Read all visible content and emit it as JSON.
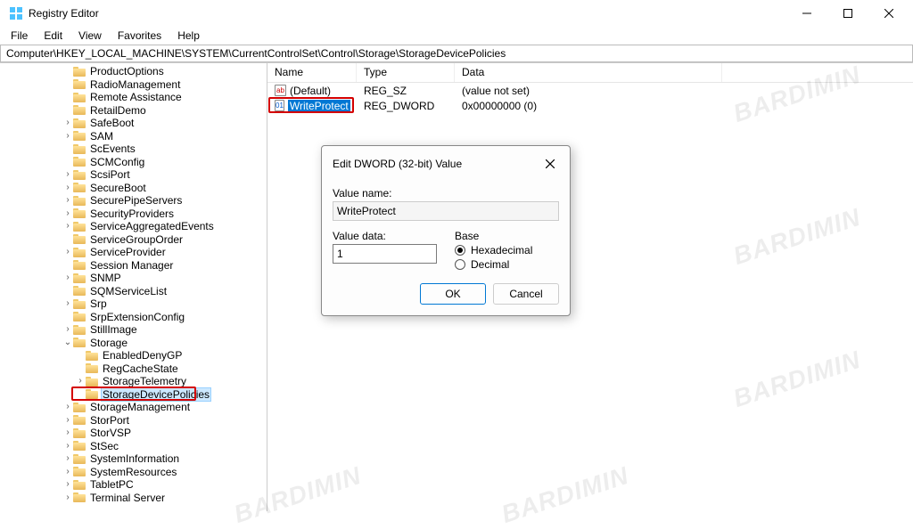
{
  "window": {
    "title": "Registry Editor",
    "min_tooltip": "Minimize",
    "max_tooltip": "Maximize",
    "close_tooltip": "Close"
  },
  "menu": {
    "file": "File",
    "edit": "Edit",
    "view": "View",
    "favorites": "Favorites",
    "help": "Help"
  },
  "address": "Computer\\HKEY_LOCAL_MACHINE\\SYSTEM\\CurrentControlSet\\Control\\Storage\\StorageDevicePolicies",
  "tree": [
    {
      "indent": 5,
      "chev": "none",
      "label": "ProductOptions"
    },
    {
      "indent": 5,
      "chev": "none",
      "label": "RadioManagement"
    },
    {
      "indent": 5,
      "chev": "none",
      "label": "Remote Assistance"
    },
    {
      "indent": 5,
      "chev": "none",
      "label": "RetailDemo"
    },
    {
      "indent": 5,
      "chev": "closed",
      "label": "SafeBoot"
    },
    {
      "indent": 5,
      "chev": "closed",
      "label": "SAM"
    },
    {
      "indent": 5,
      "chev": "none",
      "label": "ScEvents"
    },
    {
      "indent": 5,
      "chev": "none",
      "label": "SCMConfig"
    },
    {
      "indent": 5,
      "chev": "closed",
      "label": "ScsiPort"
    },
    {
      "indent": 5,
      "chev": "closed",
      "label": "SecureBoot"
    },
    {
      "indent": 5,
      "chev": "closed",
      "label": "SecurePipeServers"
    },
    {
      "indent": 5,
      "chev": "closed",
      "label": "SecurityProviders"
    },
    {
      "indent": 5,
      "chev": "closed",
      "label": "ServiceAggregatedEvents"
    },
    {
      "indent": 5,
      "chev": "none",
      "label": "ServiceGroupOrder"
    },
    {
      "indent": 5,
      "chev": "closed",
      "label": "ServiceProvider"
    },
    {
      "indent": 5,
      "chev": "none",
      "label": "Session Manager"
    },
    {
      "indent": 5,
      "chev": "closed",
      "label": "SNMP"
    },
    {
      "indent": 5,
      "chev": "none",
      "label": "SQMServiceList"
    },
    {
      "indent": 5,
      "chev": "closed",
      "label": "Srp"
    },
    {
      "indent": 5,
      "chev": "none",
      "label": "SrpExtensionConfig"
    },
    {
      "indent": 5,
      "chev": "closed",
      "label": "StillImage"
    },
    {
      "indent": 5,
      "chev": "open",
      "label": "Storage"
    },
    {
      "indent": 6,
      "chev": "none",
      "label": "EnabledDenyGP"
    },
    {
      "indent": 6,
      "chev": "none",
      "label": "RegCacheState"
    },
    {
      "indent": 6,
      "chev": "closed",
      "label": "StorageTelemetry"
    },
    {
      "indent": 6,
      "chev": "none",
      "label": "StorageDevicePolicies",
      "selected": true
    },
    {
      "indent": 5,
      "chev": "closed",
      "label": "StorageManagement"
    },
    {
      "indent": 5,
      "chev": "closed",
      "label": "StorPort"
    },
    {
      "indent": 5,
      "chev": "closed",
      "label": "StorVSP"
    },
    {
      "indent": 5,
      "chev": "closed",
      "label": "StSec"
    },
    {
      "indent": 5,
      "chev": "closed",
      "label": "SystemInformation"
    },
    {
      "indent": 5,
      "chev": "closed",
      "label": "SystemResources"
    },
    {
      "indent": 5,
      "chev": "closed",
      "label": "TabletPC"
    },
    {
      "indent": 5,
      "chev": "closed",
      "label": "Terminal Server"
    }
  ],
  "list": {
    "cols": {
      "name": "Name",
      "type": "Type",
      "data": "Data"
    },
    "col_widths": {
      "name": 100,
      "type": 110,
      "data": 300
    },
    "rows": [
      {
        "icon": "sz",
        "name": "(Default)",
        "type": "REG_SZ",
        "data": "(value not set)",
        "selected": false
      },
      {
        "icon": "dw",
        "name": "WriteProtect",
        "type": "REG_DWORD",
        "data": "0x00000000 (0)",
        "selected": true
      }
    ]
  },
  "dialog": {
    "title": "Edit DWORD (32-bit) Value",
    "value_name_label": "Value name:",
    "value_name": "WriteProtect",
    "value_data_label": "Value data:",
    "value_data": "1",
    "base_label": "Base",
    "hex_label": "Hexadecimal",
    "dec_label": "Decimal",
    "base_selected": "hex",
    "ok": "OK",
    "cancel": "Cancel"
  },
  "watermark_text": "BARDIMIN"
}
